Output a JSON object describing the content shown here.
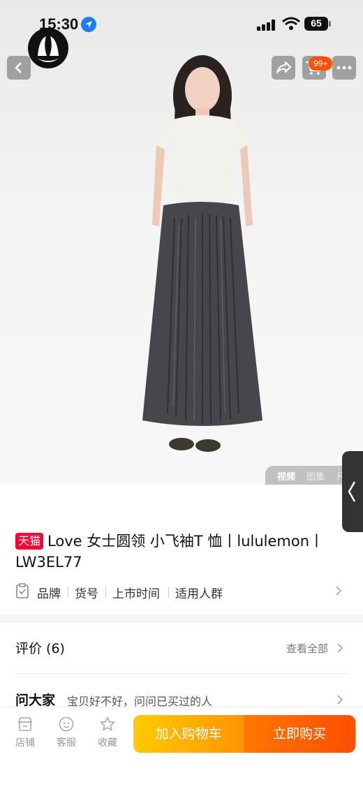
{
  "status_bar": {
    "time": "15:30",
    "battery": "65"
  },
  "header": {
    "cart_badge": "99+"
  },
  "media_tabs": [
    "视频",
    "图集",
    "尺"
  ],
  "product": {
    "badge": "天猫",
    "title": "Love 女士圆领 小飞袖T 恤丨lululemon丨LW3EL77",
    "attributes": [
      "品牌",
      "货号",
      "上市时间",
      "适用人群"
    ]
  },
  "reviews": {
    "title": "评价 (6)",
    "view_all": "查看全部"
  },
  "ask": {
    "title": "问大家",
    "subtitle": "宝贝好不好，问问已买过的人"
  },
  "bottom_bar": {
    "store": "店铺",
    "service": "客服",
    "favorite": "收藏",
    "add_to_cart": "加入购物车",
    "buy_now": "立即购买"
  },
  "colors": {
    "tmall_red": "#ff0036",
    "cart_orange": "#ff9402",
    "buy_orange": "#ff5000",
    "badge_orange": "#ff5000"
  }
}
